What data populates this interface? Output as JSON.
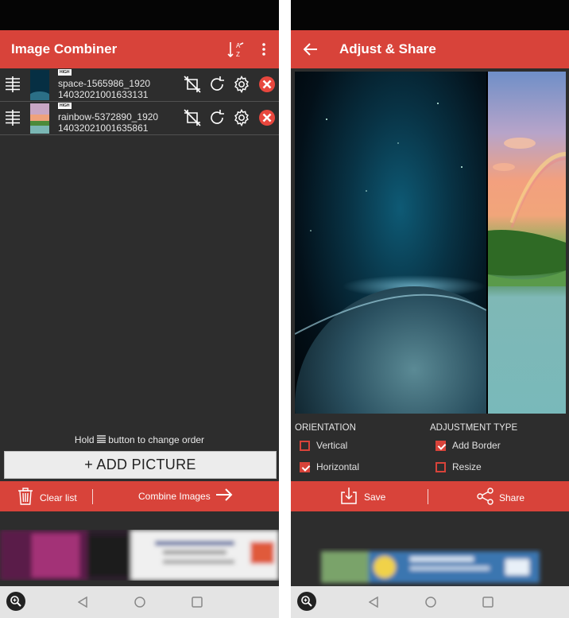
{
  "left": {
    "title": "Image Combiner",
    "images": [
      {
        "badge": "HIGH",
        "name_line1": "space-1565986_1920",
        "name_line2": "14032021001633131"
      },
      {
        "badge": "HIGH",
        "name_line1": "rainbow-5372890_1920",
        "name_line2": "14032021001635861"
      }
    ],
    "hint_prefix": "Hold",
    "hint_suffix": "button to change order",
    "add_picture": "+ ADD PICTURE",
    "clear_list": "Clear list",
    "combine_images": "Combine Images"
  },
  "right": {
    "title": "Adjust & Share",
    "orientation_title": "ORIENTATION",
    "adjustment_title": "ADJUSTMENT TYPE",
    "orientation_options": [
      {
        "label": "Vertical",
        "checked": false
      },
      {
        "label": "Horizontal",
        "checked": true
      }
    ],
    "adjustment_options": [
      {
        "label": "Add Border",
        "checked": true
      },
      {
        "label": "Resize",
        "checked": false
      }
    ],
    "save": "Save",
    "share": "Share"
  },
  "colors": {
    "accent": "#d8433a",
    "background": "#2d2d2d"
  }
}
